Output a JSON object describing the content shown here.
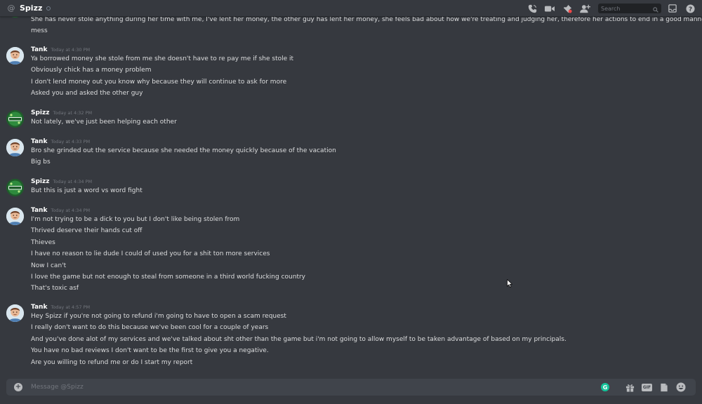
{
  "header": {
    "channel_name": "Spizz",
    "search_placeholder": "Search"
  },
  "messages": [
    {
      "author": "",
      "timestamp": "",
      "avatar": "spizz-avatar",
      "lines": [
        "She has never stole anything during her time with me, I've lent her money, the other guy has lent her money, she feels bad about how we're treating and judging her, therefore her actions to end in a good manner all this",
        "mess"
      ]
    },
    {
      "author": "Tank",
      "timestamp": "Today at 4:30 PM",
      "avatar": "tank-avatar",
      "lines": [
        "Ya borrowed money she stole from me she doesn't have to re pay me if she stole it",
        "Obviously chick has a money problem",
        "I don't lend money out you know why because they will continue to ask for  more",
        "Asked you and asked the other guy"
      ]
    },
    {
      "author": "Spizz",
      "timestamp": "Today at 4:32 PM",
      "avatar": "spizz-avatar",
      "lines": [
        "Not lately, we've just been helping each other"
      ]
    },
    {
      "author": "Tank",
      "timestamp": "Today at 4:33 PM",
      "avatar": "tank-avatar",
      "lines": [
        "Bro she grinded out the service because she needed the money quickly because of the vacation",
        "Big bs"
      ]
    },
    {
      "author": "Spizz",
      "timestamp": "Today at 4:34 PM",
      "avatar": "spizz-avatar",
      "lines": [
        "But this is just a word vs word fight"
      ]
    },
    {
      "author": "Tank",
      "timestamp": "Today at 4:34 PM",
      "avatar": "tank-avatar",
      "lines": [
        "I'm not trying to be a dick to you but I don't like being stolen from",
        "Thrived deserve their hands cut off",
        "Thieves",
        "I have no reason to lie dude I could of used you for a shit ton more services",
        "Now I can't",
        "I love the game but not enough to steal from someone in a third world fucking country",
        "That's toxic asf"
      ]
    },
    {
      "author": "Tank",
      "timestamp": "Today at 4:57 PM",
      "avatar": "tank-avatar",
      "lines": [
        "Hey Spizz if you're not going to refund i'm going to have to open a scam request",
        "I really don't want to do this because we've been cool for a couple of years",
        "And you've done alot of my services and we've talked about sht other than the game but i'm not going to allow myself to be taken advantage of based on my principals.",
        "You have no bad reviews I don't want to be the first to give you a negative.",
        "Are you willing to refund me or do I start my report"
      ]
    }
  ],
  "input": {
    "placeholder": "Message @Spizz",
    "value": "",
    "gif_label": "GIF"
  },
  "colors": {
    "background": "#36393f",
    "input_background": "#40444b",
    "text": "#dcddde",
    "author": "#ffffff",
    "muted": "#72767d",
    "notification": "#f04747"
  }
}
